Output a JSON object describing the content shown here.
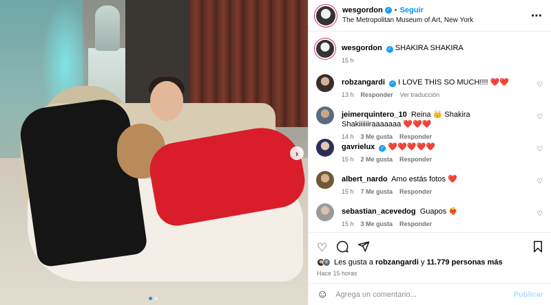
{
  "post": {
    "author": "wesgordon",
    "follow_label": "Seguir",
    "separator": "•",
    "location": "The Metropolitan Museum of Art, New York",
    "more_icon": "more-horizontal-icon"
  },
  "caption": {
    "author": "wesgordon",
    "text": "SHAKIRA SHAKIRA",
    "time": "15 h"
  },
  "comments": [
    {
      "user": "robzangardi",
      "verified": true,
      "text": "I LOVE THIS SO MUCH!!!! ❤️❤️",
      "time": "13 h",
      "likes": "",
      "reply": "Responder",
      "translate": "Ver traducción"
    },
    {
      "user": "jeimerquintero_10",
      "verified": false,
      "text": "Reina 👑 Shakira Shakiiiiiiraaaaaaa ❤️❤️❤️",
      "time": "14 h",
      "likes": "3 Me gusta",
      "reply": "Responder",
      "translate": ""
    },
    {
      "user": "gavrielux",
      "verified": true,
      "text": "❤️❤️❤️❤️❤️",
      "time": "15 h",
      "likes": "2 Me gusta",
      "reply": "Responder",
      "translate": ""
    },
    {
      "user": "albert_nardo",
      "verified": false,
      "text": "Amo estás fotos ❤️",
      "time": "15 h",
      "likes": "7 Me gusta",
      "reply": "Responder",
      "translate": ""
    },
    {
      "user": "sebastian_acevedog",
      "verified": false,
      "text": "Guapos ❤️‍🔥",
      "time": "15 h",
      "likes": "3 Me gusta",
      "reply": "Responder",
      "translate": ""
    }
  ],
  "likes": {
    "prefix": "Les gusta a",
    "first_user": "robzangardi",
    "connector": "y",
    "others": "11.779 personas más"
  },
  "timestamp": "Hace 15 horas",
  "composer": {
    "placeholder": "Agrega un comentario...",
    "publish_label": "Publicar"
  },
  "carousel": {
    "current": 1,
    "total": 2
  },
  "colors": {
    "link_blue": "#0095f6",
    "verified_blue": "#1d9bf0",
    "publish_disabled": "#b3dbff"
  }
}
